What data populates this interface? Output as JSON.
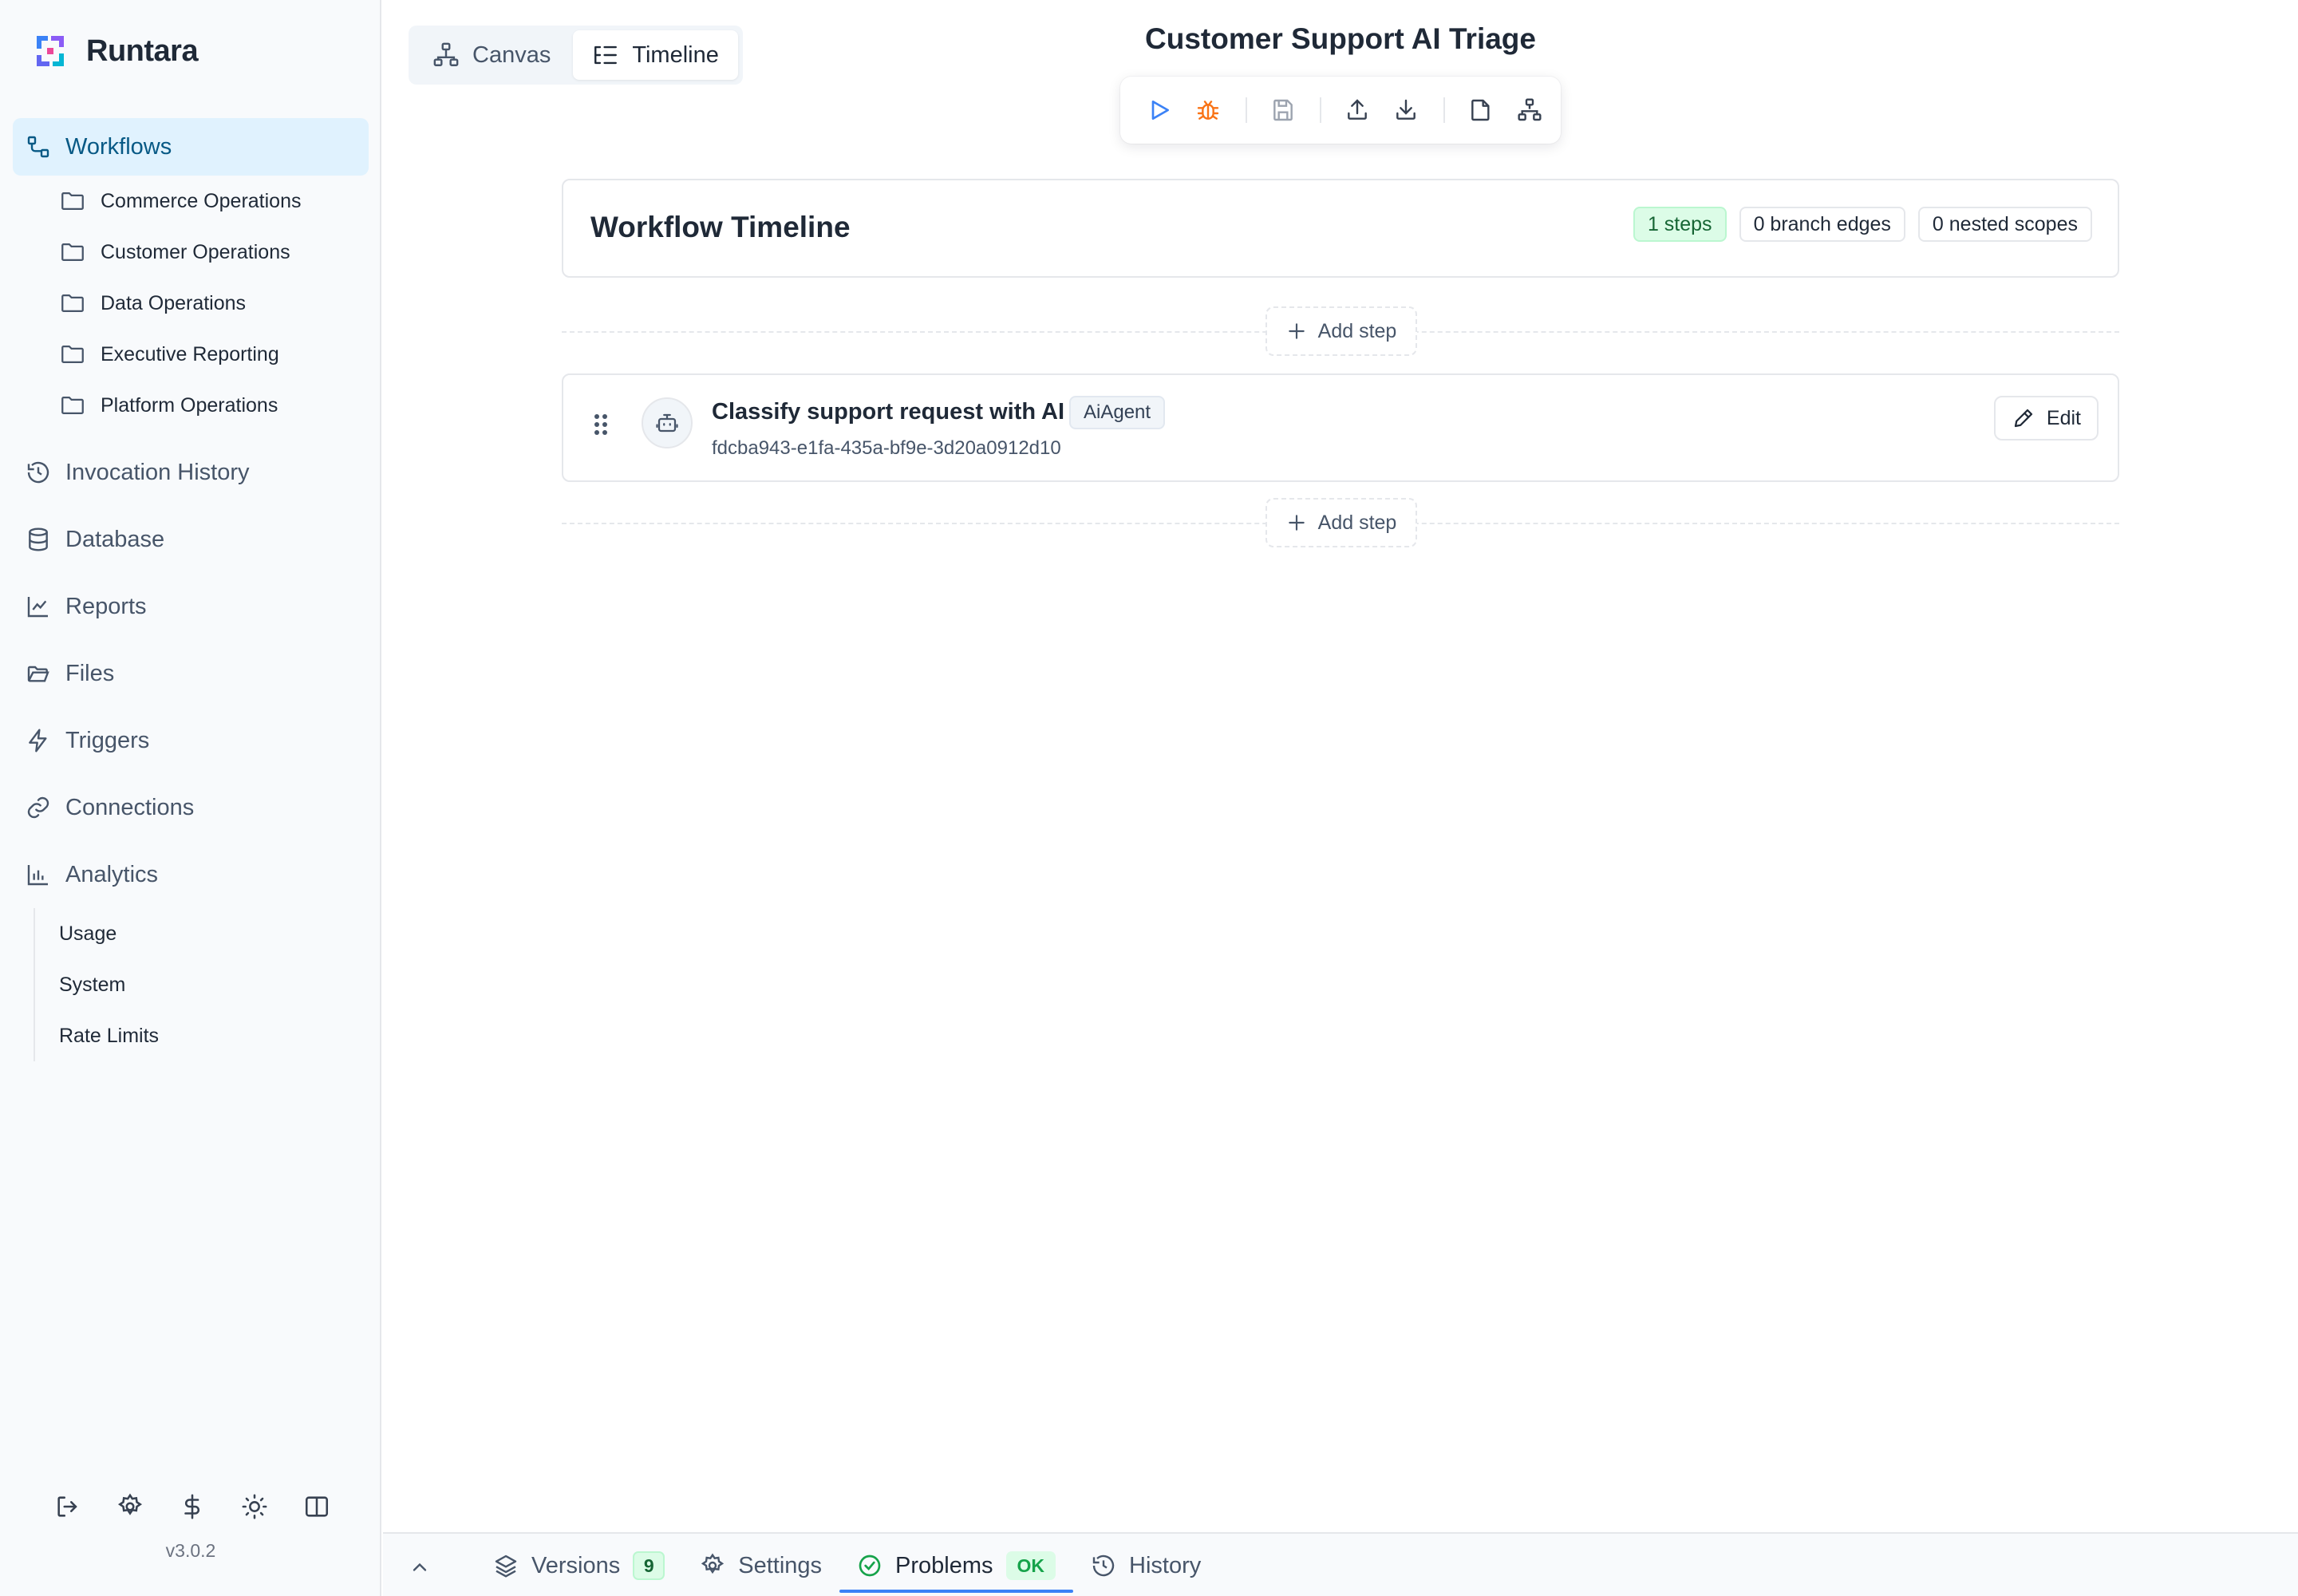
{
  "app": {
    "name": "Runtara",
    "version": "v3.0.2",
    "logo_icon": "runtara-logo-icon"
  },
  "sidebar": {
    "items": [
      {
        "label": "Workflows",
        "icon": "workflow-icon",
        "active": true
      },
      {
        "label": "Invocation History",
        "icon": "history-icon"
      },
      {
        "label": "Database",
        "icon": "database-icon"
      },
      {
        "label": "Reports",
        "icon": "line-chart-icon"
      },
      {
        "label": "Files",
        "icon": "folder-open-icon"
      },
      {
        "label": "Triggers",
        "icon": "lightning-icon"
      },
      {
        "label": "Connections",
        "icon": "link-icon"
      },
      {
        "label": "Analytics",
        "icon": "bar-chart-icon"
      }
    ],
    "workflow_folders": [
      "Commerce Operations",
      "Customer Operations",
      "Data Operations",
      "Executive Reporting",
      "Platform Operations"
    ],
    "analytics_sub": [
      "Usage",
      "System",
      "Rate Limits"
    ],
    "footer_icons": [
      "logout-icon",
      "gear-icon",
      "dollar-icon",
      "sun-icon",
      "sidebar-toggle-icon"
    ]
  },
  "view_switch": {
    "tabs": [
      {
        "label": "Canvas",
        "icon": "canvas-icon",
        "active": false
      },
      {
        "label": "Timeline",
        "icon": "timeline-icon",
        "active": true
      }
    ]
  },
  "header": {
    "title": "Customer Support AI Triage"
  },
  "toolbar": {
    "buttons": [
      "run-icon",
      "debug-icon",
      "save-icon",
      "upload-icon",
      "download-icon",
      "document-icon",
      "hierarchy-icon"
    ]
  },
  "timeline": {
    "title": "Workflow Timeline",
    "badges": {
      "steps": "1 steps",
      "branch_edges": "0 branch edges",
      "nested_scopes": "0 nested scopes"
    },
    "add_step_label": "Add step",
    "steps": [
      {
        "title": "Classify support request with AI",
        "type": "AiAgent",
        "id": "fdcba943-e1fa-435a-bf9e-3d20a0912d10",
        "edit_label": "Edit"
      }
    ]
  },
  "bottom_bar": {
    "tabs": [
      {
        "label": "Versions",
        "icon": "layers-icon",
        "count": "9"
      },
      {
        "label": "Settings",
        "icon": "gear-icon"
      },
      {
        "label": "Problems",
        "icon": "check-circle-icon",
        "status": "OK",
        "active": true
      },
      {
        "label": "History",
        "icon": "history-icon"
      }
    ]
  },
  "colors": {
    "accent": "#3b82f6",
    "active_nav_bg": "#e0f2fe",
    "active_nav_text": "#075985",
    "success": "#16a34a",
    "debug": "#f97316"
  }
}
